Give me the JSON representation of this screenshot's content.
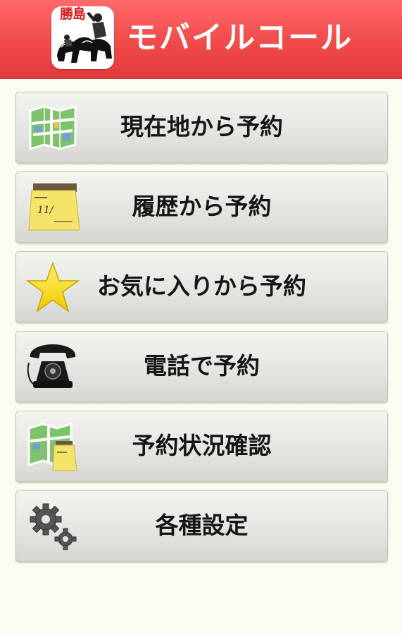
{
  "header": {
    "app_title": "モバイルコール",
    "logo_text": "勝島",
    "background_color": "#f14a4a"
  },
  "menu": {
    "items": [
      {
        "label": "現在地から予約",
        "icon": "map-icon"
      },
      {
        "label": "履歴から予約",
        "icon": "notepad-icon"
      },
      {
        "label": "お気に入りから予約",
        "icon": "star-icon"
      },
      {
        "label": "電話で予約",
        "icon": "telephone-icon"
      },
      {
        "label": "予約状況確認",
        "icon": "map-notepad-icon"
      },
      {
        "label": "各種設定",
        "icon": "gears-icon"
      }
    ]
  }
}
